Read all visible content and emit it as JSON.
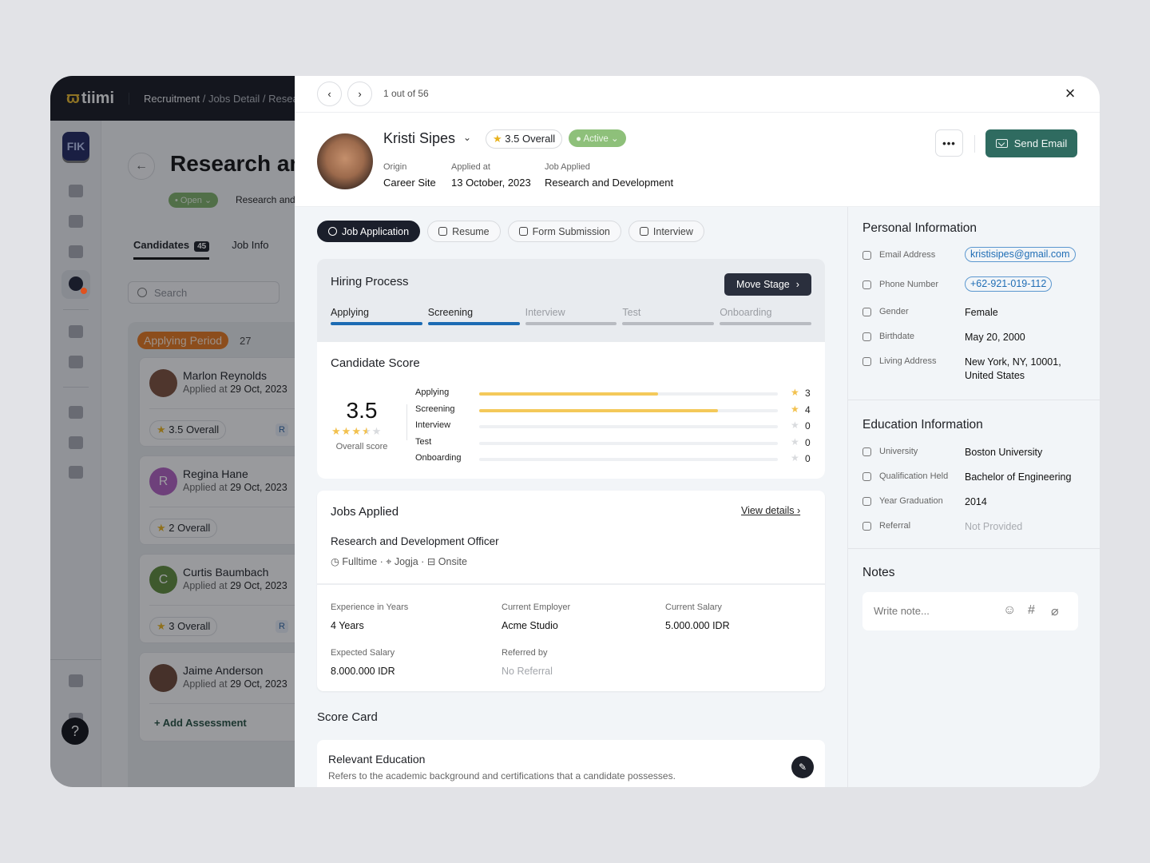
{
  "background_app": {
    "logo": {
      "mark": "ii",
      "text": "tiimi"
    },
    "breadcrumb": [
      "Recruitment",
      "Jobs Detail",
      "Research and Development"
    ],
    "org_badge": "FIK",
    "help": "?",
    "job_title": "Research and Development",
    "status_pill": "• Open ⌄",
    "job_subtitle": "Research and Development",
    "tabs": [
      {
        "label": "Candidates",
        "count": "45"
      },
      {
        "label": "Job Info"
      }
    ],
    "search_placeholder": "Search",
    "column": {
      "label": "Applying Period",
      "count": "27"
    },
    "candidates": [
      {
        "name": "Marlon Reynolds",
        "applied_prefix": "Applied at",
        "date": "29 Oct, 2023",
        "score": "3.5 Overall",
        "initial": "",
        "color": "#7a4e3a"
      },
      {
        "name": "Regina Hane",
        "applied_prefix": "Applied at",
        "date": "29 Oct, 2023",
        "score": "2 Overall",
        "initial": "R",
        "color": "#b05fc0"
      },
      {
        "name": "Curtis Baumbach",
        "applied_prefix": "Applied at",
        "date": "29 Oct, 2023",
        "score": "3 Overall",
        "initial": "C",
        "color": "#5e8a3a"
      },
      {
        "name": "Jaime Anderson",
        "applied_prefix": "Applied at",
        "date": "29 Oct, 2023",
        "score": "",
        "initial": "",
        "color": "#6c4535"
      }
    ],
    "add_assessment": "+ Add Assessment",
    "review_label": "R"
  },
  "drawer": {
    "pager": "1 out of 56",
    "candidate": {
      "name": "Kristi Sipes",
      "overall": "3.5 Overall",
      "status": "Active",
      "origin_label": "Origin",
      "origin": "Career Site",
      "applied_label": "Applied at",
      "applied": "13 October, 2023",
      "job_label": "Job Applied",
      "job": "Research and Development"
    },
    "send_email": "Send Email",
    "more": "•••",
    "tabs": [
      "Job Application",
      "Resume",
      "Form Submission",
      "Interview"
    ],
    "hiring": {
      "title": "Hiring Process",
      "move_stage": "Move Stage",
      "stages": [
        {
          "label": "Applying",
          "done": true
        },
        {
          "label": "Screening",
          "done": true
        },
        {
          "label": "Interview",
          "done": false
        },
        {
          "label": "Test",
          "done": false
        },
        {
          "label": "Onboarding",
          "done": false
        }
      ]
    },
    "score": {
      "title": "Candidate Score",
      "overall": "3.5",
      "overall_label": "Overall score",
      "rating": 3.5,
      "max": 5,
      "rows": [
        {
          "label": "Applying",
          "value": 3
        },
        {
          "label": "Screening",
          "value": 4
        },
        {
          "label": "Interview",
          "value": 0
        },
        {
          "label": "Test",
          "value": 0
        },
        {
          "label": "Onboarding",
          "value": 0
        }
      ]
    },
    "jobs_applied": {
      "title": "Jobs Applied",
      "view_details": "View details",
      "job_name": "Research and Development Officer",
      "type": "Fulltime",
      "location": "Jogja",
      "mode": "Onsite",
      "fields": [
        {
          "label": "Experience in Years",
          "value": "4 Years",
          "muted": false
        },
        {
          "label": "Current Employer",
          "value": "Acme Studio",
          "muted": false
        },
        {
          "label": "Current Salary",
          "value": "5.000.000 IDR",
          "muted": false
        },
        {
          "label": "Expected Salary",
          "value": "8.000.000 IDR",
          "muted": false
        },
        {
          "label": "Referred by",
          "value": "No Referral",
          "muted": true
        }
      ]
    },
    "score_card": {
      "title": "Score Card",
      "item_title": "Relevant Education",
      "item_desc": "Refers to the academic background and certifications that a candidate possesses."
    },
    "personal": {
      "title": "Personal Information",
      "rows": [
        {
          "icon": "mail-icon",
          "label": "Email Address",
          "value": "kristisipes@gmail.com",
          "type": "link"
        },
        {
          "icon": "phone-icon",
          "label": "Phone Number",
          "value": "+62-921-019-112",
          "type": "link"
        },
        {
          "icon": "gender-icon",
          "label": "Gender",
          "value": "Female",
          "type": "text"
        },
        {
          "icon": "cake-icon",
          "label": "Birthdate",
          "value": "May 20, 2000",
          "type": "text"
        },
        {
          "icon": "location-icon",
          "label": "Living Address",
          "value": "New York, NY, 10001, United States",
          "type": "text"
        }
      ]
    },
    "education": {
      "title": "Education Information",
      "rows": [
        {
          "icon": "building-icon",
          "label": "University",
          "value": "Boston University",
          "type": "text"
        },
        {
          "icon": "certificate-icon",
          "label": "Qualification Held",
          "value": "Bachelor of Engineering",
          "type": "text"
        },
        {
          "icon": "graduation-cap-icon",
          "label": "Year Graduation",
          "value": "2014",
          "type": "text"
        },
        {
          "icon": "user-icon",
          "label": "Referral",
          "value": "Not Provided",
          "type": "muted"
        }
      ]
    },
    "notes": {
      "title": "Notes",
      "placeholder": "Write note..."
    }
  },
  "colors": {
    "accent": "#2f6b60",
    "progress": "#1c6bb3",
    "star": "#f2c14e",
    "status_active": "#8ec07a",
    "period": "#e4761d"
  }
}
